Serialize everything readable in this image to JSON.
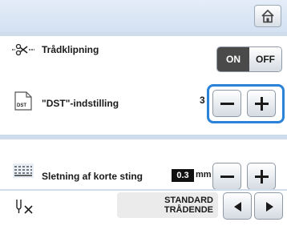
{
  "header": {
    "home_icon": "home-icon"
  },
  "rows": [
    {
      "label": "Trådklipning",
      "icon": "thread-cut-icon",
      "toggle": {
        "on_label": "ON",
        "off_label": "OFF",
        "state": "on"
      }
    },
    {
      "label": "\"DST\"-indstilling",
      "icon": "dst-file-icon",
      "file_tag": "DST",
      "value_fragment": "3"
    },
    {
      "label": "Sletning af korte sting",
      "icon": "short-stitch-icon",
      "value": "0.3",
      "unit": "mm"
    },
    {
      "icon": "thread-end-icon",
      "option_line1": "STANDARD",
      "option_line2": "TRÅDENDE"
    }
  ],
  "colors": {
    "focus": "#2b82d9",
    "header": "#dbe6f4",
    "on_bg": "#4a4a4a"
  }
}
